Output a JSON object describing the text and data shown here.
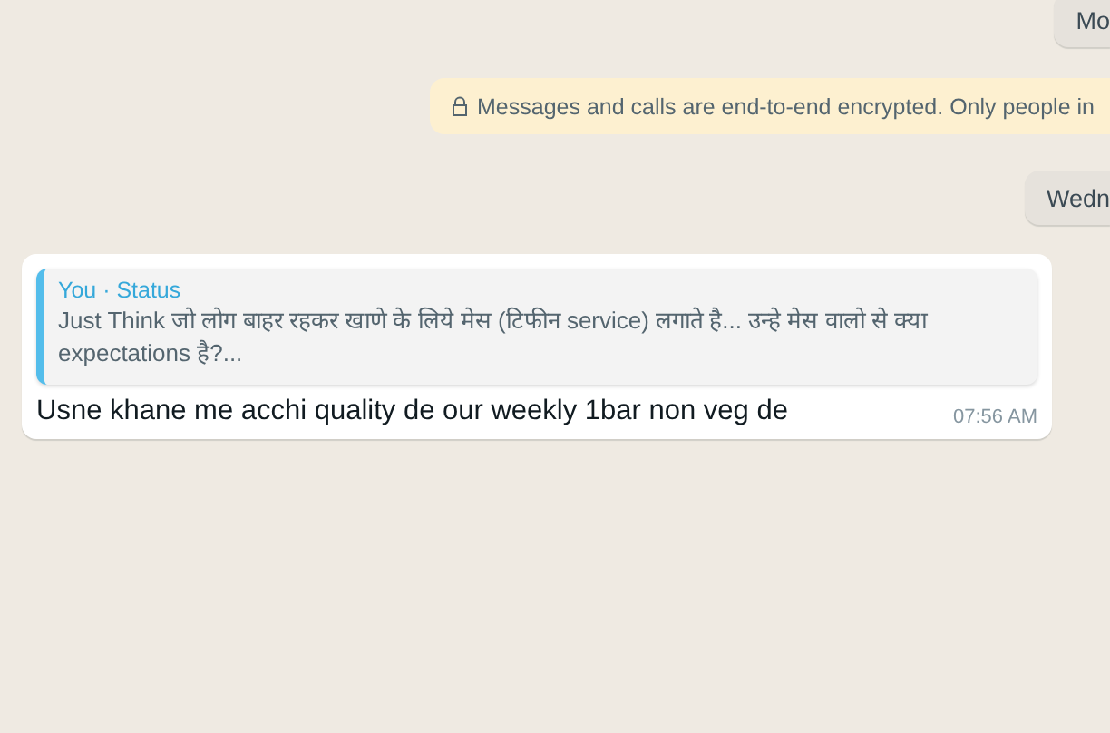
{
  "date_chips": [
    {
      "label": "Mo"
    },
    {
      "label": "Wedn"
    }
  ],
  "encryption_notice": {
    "text": "Messages and calls are end-to-end encrypted. Only people in"
  },
  "message": {
    "quote": {
      "author": "You · Status",
      "text": "Just Think जो लोग बाहर रहकर खाणे के लिये मेस (टिफीन service) लगाते है... उन्हे मेस वालो से क्या expectations है?..."
    },
    "text": "Usne khane me acchi quality de our weekly 1bar non veg de",
    "time": "07:56 AM"
  }
}
